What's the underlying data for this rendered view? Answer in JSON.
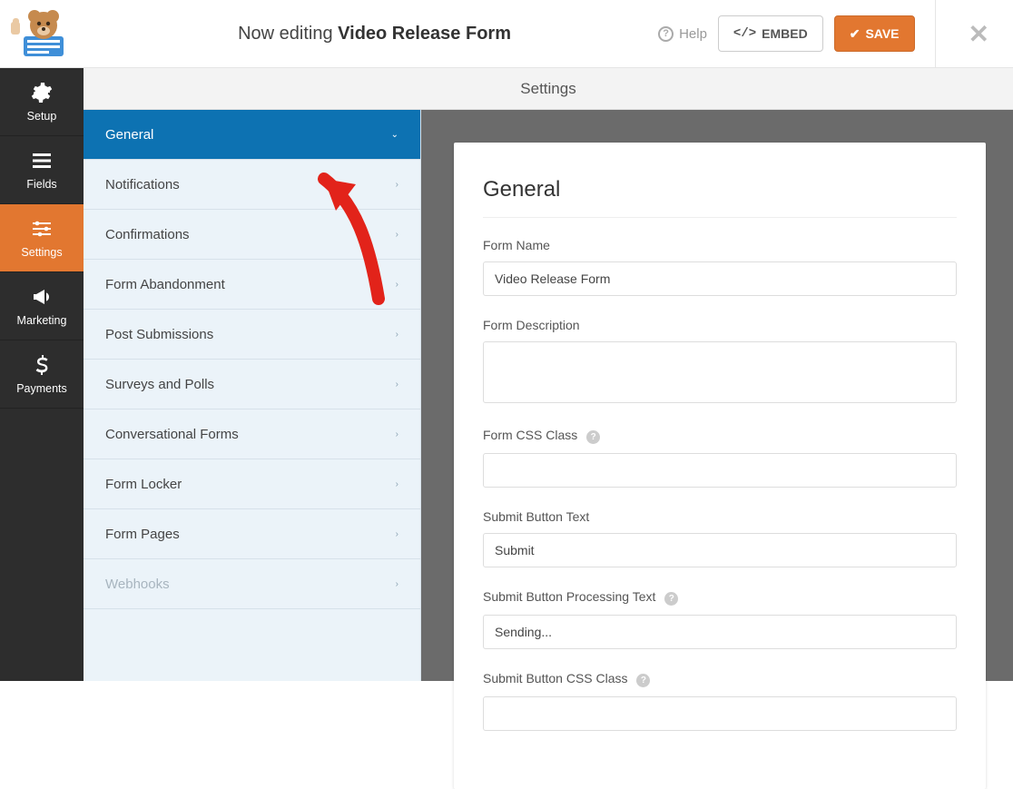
{
  "header": {
    "editing_prefix": "Now editing",
    "form_title": "Video Release Form",
    "help_label": "Help",
    "embed_label": "EMBED",
    "save_label": "SAVE"
  },
  "leftnav": {
    "items": [
      {
        "id": "setup",
        "label": "Setup"
      },
      {
        "id": "fields",
        "label": "Fields"
      },
      {
        "id": "settings",
        "label": "Settings",
        "active": true
      },
      {
        "id": "marketing",
        "label": "Marketing"
      },
      {
        "id": "payments",
        "label": "Payments"
      }
    ]
  },
  "subheader": {
    "title": "Settings"
  },
  "settings_menu": {
    "items": [
      {
        "label": "General",
        "active": true,
        "expanded": true
      },
      {
        "label": "Notifications"
      },
      {
        "label": "Confirmations"
      },
      {
        "label": "Form Abandonment"
      },
      {
        "label": "Post Submissions"
      },
      {
        "label": "Surveys and Polls"
      },
      {
        "label": "Conversational Forms"
      },
      {
        "label": "Form Locker"
      },
      {
        "label": "Form Pages"
      },
      {
        "label": "Webhooks",
        "disabled": true
      }
    ]
  },
  "panel": {
    "title": "General",
    "fields": {
      "form_name": {
        "label": "Form Name",
        "value": "Video Release Form"
      },
      "form_desc": {
        "label": "Form Description",
        "value": ""
      },
      "form_css": {
        "label": "Form CSS Class",
        "value": "",
        "hint": true
      },
      "submit_text": {
        "label": "Submit Button Text",
        "value": "Submit"
      },
      "submit_proc": {
        "label": "Submit Button Processing Text",
        "value": "Sending...",
        "hint": true
      },
      "submit_css": {
        "label": "Submit Button CSS Class",
        "value": "",
        "hint": true
      }
    }
  }
}
